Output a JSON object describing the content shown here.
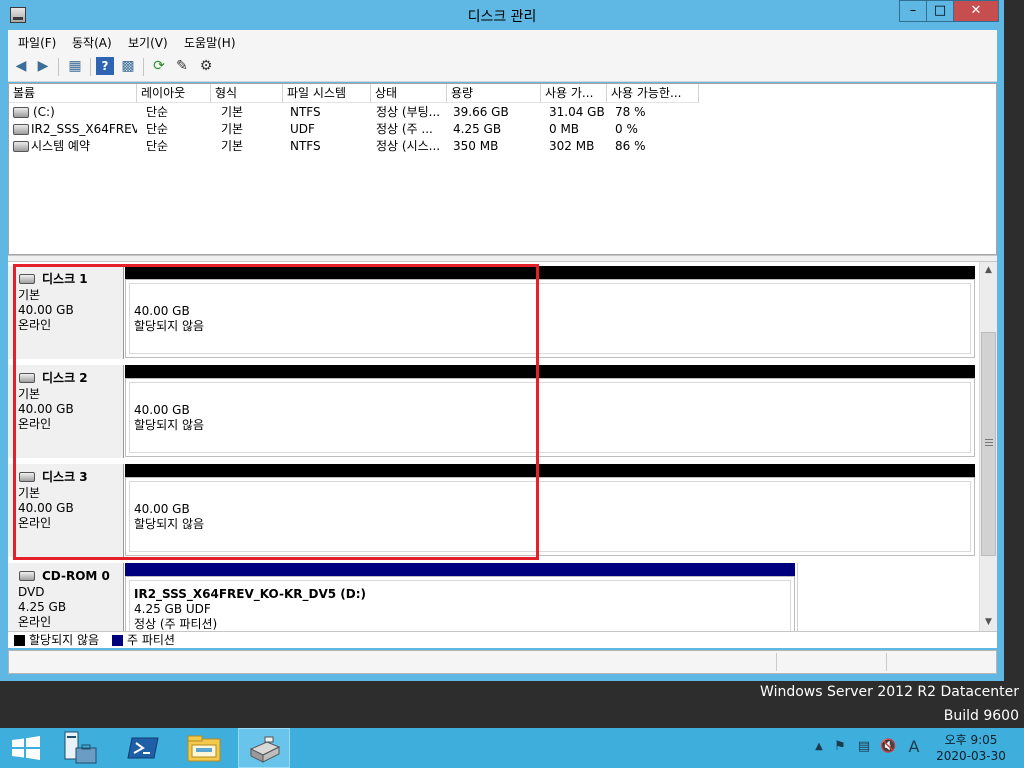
{
  "window": {
    "title": "디스크 관리",
    "buttons": {
      "minimize": "–",
      "maximize": "□",
      "close": "✕"
    }
  },
  "menu": [
    "파일(F)",
    "동작(A)",
    "보기(V)",
    "도움말(H)"
  ],
  "toolbar": {
    "icons": [
      "back-icon",
      "forward-icon",
      "console-tree-icon",
      "help-icon",
      "action-pane-icon",
      "refresh-icon",
      "properties-icon",
      "settings-icon"
    ]
  },
  "volume_list": {
    "columns": [
      "볼륨",
      "레이아웃",
      "형식",
      "파일 시스템",
      "상태",
      "용량",
      "사용 가...",
      "사용 가능한..."
    ],
    "rows": [
      {
        "volume": "(C:)",
        "layout": "단순",
        "type": "기본",
        "fs": "NTFS",
        "status": "정상 (부팅...",
        "capacity": "39.66 GB",
        "free": "31.04 GB",
        "pct": "78 %"
      },
      {
        "volume": "IR2_SSS_X64FREV...",
        "layout": "단순",
        "type": "기본",
        "fs": "UDF",
        "status": "정상 (주 ...",
        "capacity": "4.25 GB",
        "free": "0 MB",
        "pct": "0 %"
      },
      {
        "volume": "시스템 예약",
        "layout": "단순",
        "type": "기본",
        "fs": "NTFS",
        "status": "정상 (시스...",
        "capacity": "350 MB",
        "free": "302 MB",
        "pct": "86 %"
      }
    ]
  },
  "disks": [
    {
      "name": "디스크 1",
      "type": "기본",
      "size": "40.00 GB",
      "state": "온라인",
      "partition": {
        "size": "40.00 GB",
        "label": "할당되지 않음"
      }
    },
    {
      "name": "디스크 2",
      "type": "기본",
      "size": "40.00 GB",
      "state": "온라인",
      "partition": {
        "size": "40.00 GB",
        "label": "할당되지 않음"
      }
    },
    {
      "name": "디스크 3",
      "type": "기본",
      "size": "40.00 GB",
      "state": "온라인",
      "partition": {
        "size": "40.00 GB",
        "label": "할당되지 않음"
      }
    }
  ],
  "cdrom": {
    "name": "CD-ROM 0",
    "type": "DVD",
    "size": "4.25 GB",
    "state": "온라인",
    "partition": {
      "title": "IR2_SSS_X64FREV_KO-KR_DV5  (D:)",
      "fs": "4.25 GB UDF",
      "status": "정상 (주 파티션)"
    }
  },
  "legend": [
    {
      "label": "할당되지 않음",
      "color": "#000000"
    },
    {
      "label": "주 파티션",
      "color": "#00007f"
    }
  ],
  "colors": {
    "unallocated": "#000000",
    "primary": "#00007f",
    "highlight": "#e6202a"
  },
  "desktop": {
    "edition": "Windows Server 2012 R2 Datacenter",
    "build": "Build 9600"
  },
  "taskbar": {
    "apps": [
      "start-icon",
      "server-manager-icon",
      "powershell-icon",
      "file-explorer-icon",
      "disk-management-icon"
    ],
    "tray_icons": [
      "show-hidden-icons",
      "flag-icon",
      "network-icon",
      "volume-muted-icon",
      "ime-icon"
    ],
    "ime": "A",
    "time": "오후 9:05",
    "date": "2020-03-30"
  }
}
